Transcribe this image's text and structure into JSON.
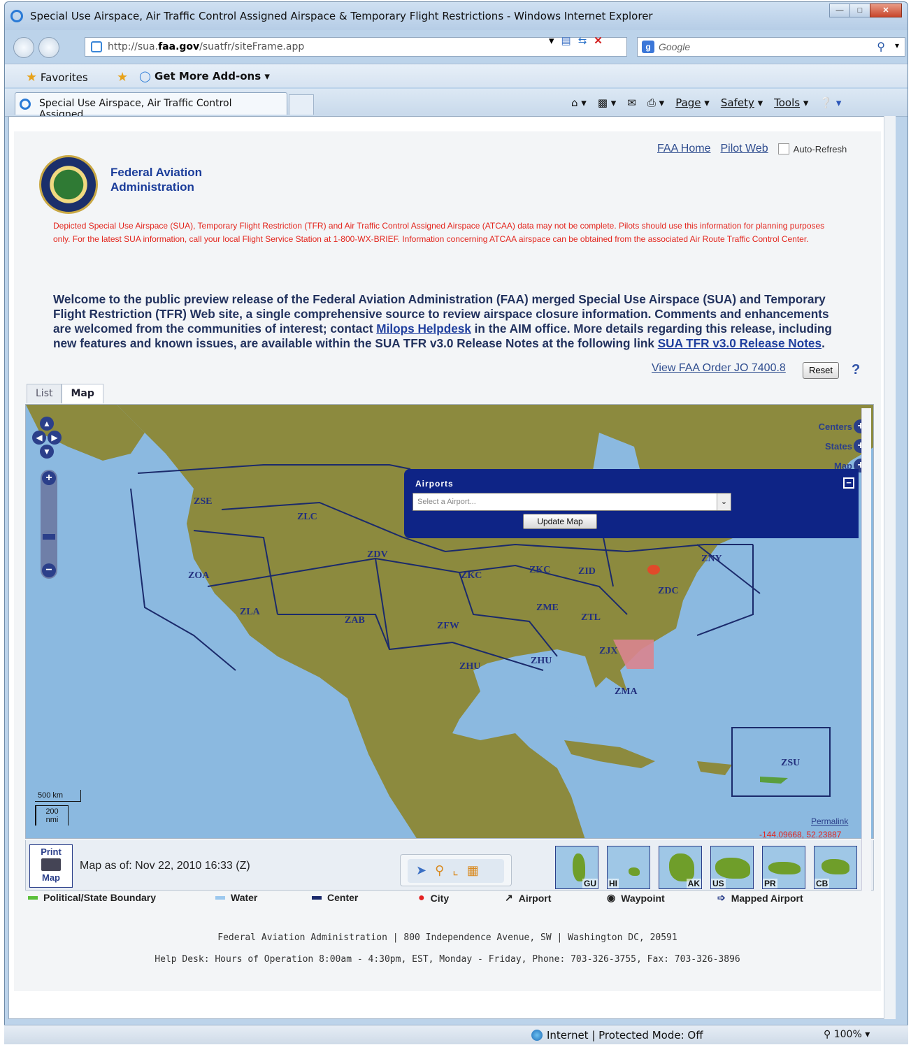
{
  "window": {
    "title": "Special Use Airspace, Air Traffic Control Assigned Airspace & Temporary Flight Restrictions - Windows Internet Explorer"
  },
  "address_bar": {
    "url_prefix": "http://sua.",
    "url_domain": "faa.gov",
    "url_path": "/suatfr/siteFrame.app"
  },
  "search": {
    "placeholder": "Google"
  },
  "favorites_bar": {
    "favorites_label": "Favorites",
    "addons_label": "Get More Add-ons"
  },
  "browser_tab": {
    "label": "Special Use Airspace, Air Traffic Control Assigned..."
  },
  "command_bar": {
    "page_label": "Page",
    "safety_label": "Safety",
    "tools_label": "Tools"
  },
  "header": {
    "org_line1": "Federal Aviation",
    "org_line2": "Administration",
    "faa_home_link": "FAA Home",
    "pilot_web_link": "Pilot Web",
    "auto_refresh_label": "Auto-Refresh"
  },
  "disclaimer": "Depicted Special Use Airspace (SUA), Temporary Flight Restriction (TFR) and Air Traffic Control Assigned Airspace (ATCAA) data may not be complete. Pilots should use this information for planning purposes only. For the latest SUA information, call your local Flight Service Station at 1-800-WX-BRIEF. Information concerning ATCAA airspace can be obtained from the associated Air Route Traffic Control Center.",
  "welcome": {
    "text1": "Welcome to the public preview release of the Federal Aviation Administration (FAA) merged Special Use Airspace (SUA) and Temporary Flight Restriction (TFR) Web site, a single comprehensive source to review airspace closure information. Comments and enhancements are welcomed from the communities of interest; contact ",
    "helpdesk_link": "Milops Helpdesk",
    "text2": " in the AIM office. More details regarding this release, including new features and known issues, are available within the SUA TFR v3.0 Release Notes at the following link ",
    "release_link": "SUA TFR v3.0 Release Notes",
    "text3": "."
  },
  "order_link": "View FAA Order JO 7400.8",
  "reset_button": "Reset",
  "map_tabs": [
    {
      "label": "List"
    },
    {
      "label": "Map"
    }
  ],
  "map": {
    "layer_controls": [
      "Centers",
      "States",
      "Map"
    ],
    "airports_panel": {
      "title": "Airports",
      "select_placeholder": "Select a Airport...",
      "update_button": "Update Map"
    },
    "center_labels": [
      "ZSE",
      "ZLC",
      "ZOA",
      "ZDV",
      "ZLA",
      "ZAB",
      "ZKC",
      "ZKC",
      "ZID",
      "ZNY",
      "ZDC",
      "ZME",
      "ZTL",
      "ZFW",
      "ZHU",
      "ZHU",
      "ZJX",
      "ZMA",
      "ZSU"
    ],
    "scale_km": "500 km",
    "scale_nmi_value": "200",
    "scale_nmi_unit": "nmi",
    "permalink": "Permalink",
    "coords": "-144.09668, 52.23887"
  },
  "map_footer": {
    "print_line1": "Print",
    "print_line2": "Map",
    "map_as_of": "Map as of: Nov 22, 2010 16:33 (Z)",
    "regions": [
      "GU",
      "HI",
      "AK",
      "US",
      "PR",
      "CB"
    ]
  },
  "legend": [
    {
      "label": "Political/State Boundary",
      "color": "#5bbf3a"
    },
    {
      "label": "Water",
      "color": "#9cc8ee"
    },
    {
      "label": "Center",
      "color": "#1b2a6b"
    },
    {
      "label": "City",
      "color": "#e32020"
    },
    {
      "label": "Airport",
      "icon": "airport-icon"
    },
    {
      "label": "Waypoint",
      "icon": "waypoint-icon"
    },
    {
      "label": "Mapped Airport",
      "icon": "pin-icon"
    }
  ],
  "footer": {
    "line1": "Federal Aviation Administration  |  800 Independence Avenue, SW  |  Washington DC, 20591",
    "line2": "Help Desk: Hours of Operation 8:00am - 4:30pm, EST, Monday - Friday, Phone: 703-326-3755, Fax: 703-326-3896"
  },
  "status_bar": {
    "zone": "Internet | Protected Mode: Off",
    "zoom": "100%"
  }
}
